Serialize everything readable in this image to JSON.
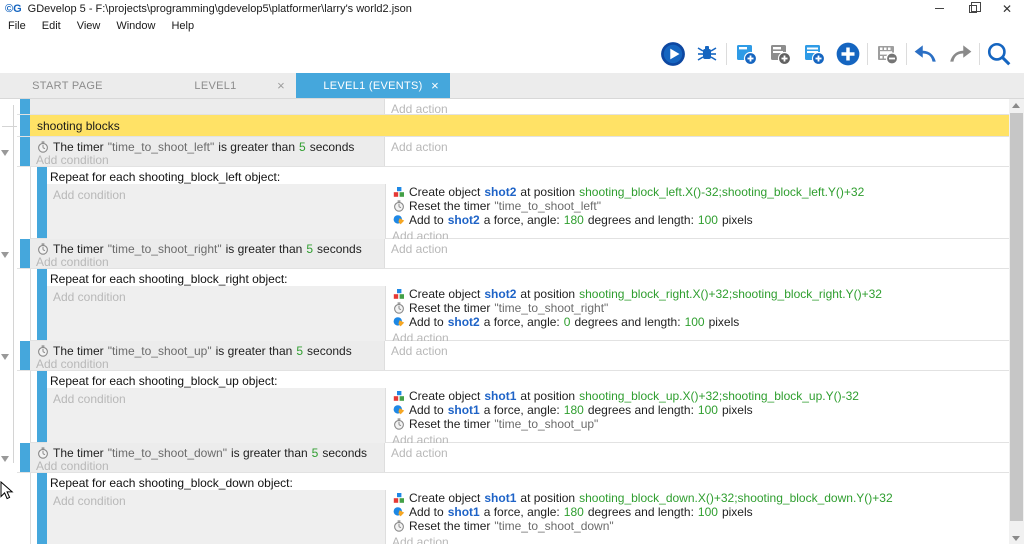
{
  "window": {
    "title": "GDevelop 5 - F:\\projects\\programming\\gdevelop5\\platformer\\larry's world2.json"
  },
  "menu": [
    "File",
    "Edit",
    "View",
    "Window",
    "Help"
  ],
  "toolbar": {
    "icon_names": [
      "play-icon",
      "debug-icon",
      "add-event-icon",
      "add-subevent-icon",
      "add-comment-icon",
      "add-new-icon",
      "remove-event-icon",
      "undo-icon",
      "redo-icon",
      "search-icon"
    ]
  },
  "tabs": [
    {
      "label": "START PAGE",
      "active": false
    },
    {
      "label": "LEVEL1",
      "active": false,
      "close": "×"
    },
    {
      "label": "LEVEL1 (EVENTS)",
      "active": true,
      "close": "×"
    }
  ],
  "placeholders": {
    "add_condition": "Add condition",
    "add_action": "Add action"
  },
  "colors": {
    "accent": "#45a7dc",
    "comment_bg": "#ffe266",
    "number_green": "#2f9e2f",
    "object_blue": "#1e63c7"
  },
  "events": [
    {
      "type": "partial"
    },
    {
      "type": "comment",
      "text": "shooting blocks"
    },
    {
      "type": "group",
      "condition": {
        "icon": "timer-icon",
        "segments": [
          {
            "t": "The timer ",
            "s": "p"
          },
          {
            "t": "\"time_to_shoot_left\"",
            "s": "str"
          },
          {
            "t": " is greater than ",
            "s": "p"
          },
          {
            "t": "5",
            "s": "num"
          },
          {
            "t": " seconds",
            "s": "p"
          }
        ]
      },
      "repeat_header": "Repeat for each shooting_block_left object:",
      "actions": [
        {
          "icon": "create-object-icon",
          "segments": [
            {
              "t": "Create object ",
              "s": "p"
            },
            {
              "t": "shot2",
              "s": "obj"
            },
            {
              "t": " at position ",
              "s": "p"
            },
            {
              "t": "shooting_block_left.X()-32;shooting_block_left.Y()+32",
              "s": "num"
            }
          ]
        },
        {
          "icon": "timer-icon",
          "segments": [
            {
              "t": "Reset the timer ",
              "s": "p"
            },
            {
              "t": "\"time_to_shoot_left\"",
              "s": "str"
            }
          ]
        },
        {
          "icon": "force-icon",
          "segments": [
            {
              "t": "Add to ",
              "s": "p"
            },
            {
              "t": "shot2",
              "s": "obj"
            },
            {
              "t": " a force, angle: ",
              "s": "p"
            },
            {
              "t": "180",
              "s": "num"
            },
            {
              "t": " degrees and length: ",
              "s": "p"
            },
            {
              "t": "100",
              "s": "num"
            },
            {
              "t": " pixels",
              "s": "p"
            }
          ]
        }
      ]
    },
    {
      "type": "group",
      "condition": {
        "icon": "timer-icon",
        "segments": [
          {
            "t": "The timer ",
            "s": "p"
          },
          {
            "t": "\"time_to_shoot_right\"",
            "s": "str"
          },
          {
            "t": " is greater than ",
            "s": "p"
          },
          {
            "t": "5",
            "s": "num"
          },
          {
            "t": " seconds",
            "s": "p"
          }
        ]
      },
      "repeat_header": "Repeat for each shooting_block_right object:",
      "actions": [
        {
          "icon": "create-object-icon",
          "segments": [
            {
              "t": "Create object ",
              "s": "p"
            },
            {
              "t": "shot2",
              "s": "obj"
            },
            {
              "t": " at position ",
              "s": "p"
            },
            {
              "t": "shooting_block_right.X()+32;shooting_block_right.Y()+32",
              "s": "num"
            }
          ]
        },
        {
          "icon": "timer-icon",
          "segments": [
            {
              "t": "Reset the timer ",
              "s": "p"
            },
            {
              "t": "\"time_to_shoot_right\"",
              "s": "str"
            }
          ]
        },
        {
          "icon": "force-icon",
          "segments": [
            {
              "t": "Add to ",
              "s": "p"
            },
            {
              "t": "shot2",
              "s": "obj"
            },
            {
              "t": " a force, angle: ",
              "s": "p"
            },
            {
              "t": "0",
              "s": "num"
            },
            {
              "t": " degrees and length: ",
              "s": "p"
            },
            {
              "t": "100",
              "s": "num"
            },
            {
              "t": " pixels",
              "s": "p"
            }
          ]
        }
      ]
    },
    {
      "type": "group",
      "condition": {
        "icon": "timer-icon",
        "segments": [
          {
            "t": "The timer ",
            "s": "p"
          },
          {
            "t": "\"time_to_shoot_up\"",
            "s": "str"
          },
          {
            "t": " is greater than ",
            "s": "p"
          },
          {
            "t": "5",
            "s": "num"
          },
          {
            "t": " seconds",
            "s": "p"
          }
        ]
      },
      "repeat_header": "Repeat for each shooting_block_up object:",
      "actions": [
        {
          "icon": "create-object-icon",
          "segments": [
            {
              "t": "Create object ",
              "s": "p"
            },
            {
              "t": "shot1",
              "s": "obj"
            },
            {
              "t": " at position ",
              "s": "p"
            },
            {
              "t": "shooting_block_up.X()+32;shooting_block_up.Y()-32",
              "s": "num"
            }
          ]
        },
        {
          "icon": "force-icon",
          "segments": [
            {
              "t": "Add to ",
              "s": "p"
            },
            {
              "t": "shot1",
              "s": "obj"
            },
            {
              "t": " a force, angle: ",
              "s": "p"
            },
            {
              "t": "180",
              "s": "num"
            },
            {
              "t": " degrees and length: ",
              "s": "p"
            },
            {
              "t": "100",
              "s": "num"
            },
            {
              "t": " pixels",
              "s": "p"
            }
          ]
        },
        {
          "icon": "timer-icon",
          "segments": [
            {
              "t": "Reset the timer ",
              "s": "p"
            },
            {
              "t": "\"time_to_shoot_up\"",
              "s": "str"
            }
          ]
        }
      ]
    },
    {
      "type": "group",
      "condition": {
        "icon": "timer-icon",
        "segments": [
          {
            "t": "The timer ",
            "s": "p"
          },
          {
            "t": "\"time_to_shoot_down\"",
            "s": "str"
          },
          {
            "t": " is greater than ",
            "s": "p"
          },
          {
            "t": "5",
            "s": "num"
          },
          {
            "t": " seconds",
            "s": "p"
          }
        ]
      },
      "repeat_header": "Repeat for each shooting_block_down object:",
      "actions": [
        {
          "icon": "create-object-icon",
          "segments": [
            {
              "t": "Create object ",
              "s": "p"
            },
            {
              "t": "shot1",
              "s": "obj"
            },
            {
              "t": " at position ",
              "s": "p"
            },
            {
              "t": "shooting_block_down.X()+32;shooting_block_down.Y()+32",
              "s": "num"
            }
          ]
        },
        {
          "icon": "force-icon",
          "segments": [
            {
              "t": "Add to ",
              "s": "p"
            },
            {
              "t": "shot1",
              "s": "obj"
            },
            {
              "t": " a force, angle: ",
              "s": "p"
            },
            {
              "t": "180",
              "s": "num"
            },
            {
              "t": " degrees and length: ",
              "s": "p"
            },
            {
              "t": "100",
              "s": "num"
            },
            {
              "t": " pixels",
              "s": "p"
            }
          ]
        },
        {
          "icon": "timer-icon",
          "segments": [
            {
              "t": "Reset the timer ",
              "s": "p"
            },
            {
              "t": "\"time_to_shoot_down\"",
              "s": "str"
            }
          ]
        }
      ]
    }
  ]
}
